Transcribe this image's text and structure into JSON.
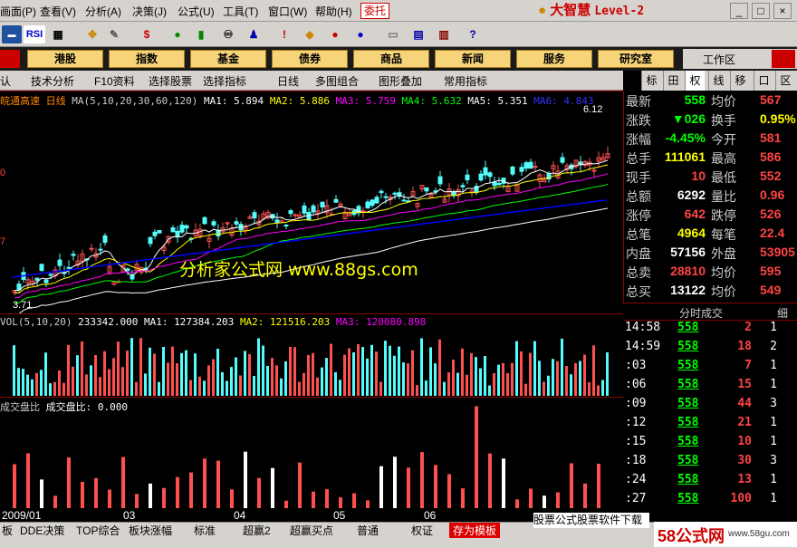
{
  "menu": [
    "画面(P)",
    "查看(V)",
    "分析(A)",
    "决策(J)",
    "公式(U)",
    "工具(T)",
    "窗口(W)",
    "帮助(H)"
  ],
  "trust_button": "委托",
  "app_logo": "大智慧",
  "app_level": "Level-2",
  "window_buttons": [
    "_",
    "□",
    "×"
  ],
  "nav_buttons": [
    "港股",
    "指数",
    "基金",
    "债券",
    "商品",
    "新闻",
    "服务",
    "研究室"
  ],
  "workspace_label": "工作区",
  "subbar": [
    "认",
    "技术分析",
    "F10资料",
    "选择股票",
    "选择指标",
    "日线",
    "多图组合",
    "图形叠加",
    "常用指标"
  ],
  "right_tabs": [
    "标",
    "田",
    "权",
    "线",
    "移",
    "口",
    "区"
  ],
  "chart_title": {
    "name": "皖通高速",
    "period": "日线",
    "ma_label": "MA(5,10,20,30,60,120)",
    "ma1": "MA1: 5.894",
    "ma2": "MA2: 5.886",
    "ma3": "MA3: 5.759",
    "ma4": "MA4: 5.632",
    "ma5": "MA5: 5.351",
    "ma6": "MA6: 4.843"
  },
  "high_label": "6.12",
  "low_label": "3.71",
  "left_ticks": [
    "0",
    "7"
  ],
  "watermark": "分析家公式网 www.88gs.com",
  "vol_indicator": {
    "name": "VOL(5,10,20)",
    "value": "233342.000",
    "ma1": "MA1: 127384.203",
    "ma2": "MA2: 121516.203",
    "ma3": "MA3: 120080.898"
  },
  "ratio_indicator": {
    "name": "成交盘比",
    "label": "成交盘比:",
    "value": "0.000"
  },
  "dates": [
    "2009/01",
    "03",
    "04",
    "05",
    "06"
  ],
  "quote": [
    {
      "l1": "最新",
      "v1": "558",
      "l2": "均价",
      "v2": "567"
    },
    {
      "l1": "涨跌",
      "v1": "▼026",
      "l2": "换手",
      "v2": "0.95%"
    },
    {
      "l1": "涨幅",
      "v1": "-4.45%",
      "l2": "今开",
      "v2": "581"
    },
    {
      "l1": "总手",
      "v1": "111061",
      "l2": "最高",
      "v2": "586"
    },
    {
      "l1": "现手",
      "v1": "10",
      "l2": "最低",
      "v2": "552"
    },
    {
      "l1": "总额",
      "v1": "6292",
      "l2": "量比",
      "v2": "0.96"
    },
    {
      "l1": "涨停",
      "v1": "642",
      "l2": "跌停",
      "v2": "526"
    },
    {
      "l1": "总笔",
      "v1": "4964",
      "l2": "每笔",
      "v2": "22.4"
    },
    {
      "l1": "内盘",
      "v1": "57156",
      "l2": "外盘",
      "v2": "53905"
    },
    {
      "l1": "总卖",
      "v1": "28810",
      "l2": "均价",
      "v2": "595"
    },
    {
      "l1": "总买",
      "v1": "13122",
      "l2": "均价",
      "v2": "549"
    }
  ],
  "ts_header": "分时成交",
  "ts_more": "细",
  "trades": [
    {
      "t": "14:58",
      "p": "558",
      "v": "2",
      "n": "1"
    },
    {
      "t": "14:59",
      "p": "558",
      "v": "18",
      "n": "2"
    },
    {
      "t": ":03",
      "p": "558",
      "v": "7",
      "n": "1"
    },
    {
      "t": ":06",
      "p": "558",
      "v": "15",
      "n": "1"
    },
    {
      "t": ":09",
      "p": "558",
      "v": "44",
      "n": "3"
    },
    {
      "t": ":12",
      "p": "558",
      "v": "21",
      "n": "1"
    },
    {
      "t": ":15",
      "p": "558",
      "v": "10",
      "n": "1"
    },
    {
      "t": ":18",
      "p": "558",
      "v": "30",
      "n": "3"
    },
    {
      "t": ":24",
      "p": "558",
      "v": "13",
      "n": "1"
    },
    {
      "t": ":27",
      "p": "558",
      "v": "100",
      "n": "1"
    }
  ],
  "bottom_tabs": [
    "板",
    "DDE决策",
    "TOP综合",
    "板块涨幅",
    "标准",
    "超赢2",
    "超赢买点",
    "普通",
    "权证",
    "存为模板"
  ],
  "promo_text": "股票公式股票软件下载",
  "wm_logo": "58公式网",
  "wm_url": "www.58gu.com",
  "colors": {
    "up": "#ff5050",
    "down": "#54fcfc",
    "ma1": "#ffffff",
    "ma2": "#ffff00",
    "ma3": "#ff00ff",
    "ma4": "#00ff00",
    "ma5": "#ffffff",
    "ma6": "#0000ff"
  }
}
